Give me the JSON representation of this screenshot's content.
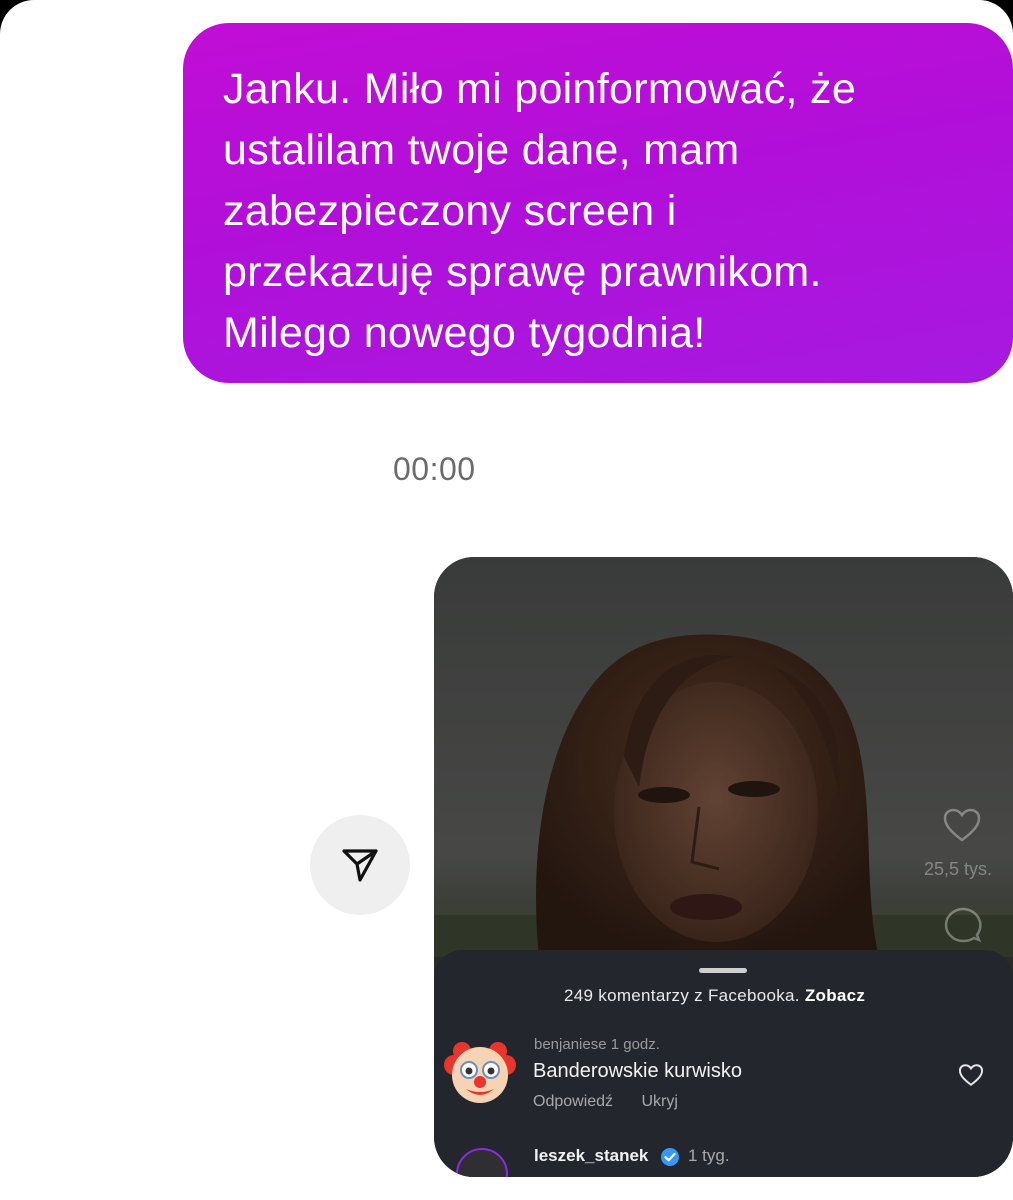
{
  "message": {
    "lines": [
      "Janku. Miło mi poinformować, że",
      "ustalilam twoje dane, mam",
      "zabezpieczony screen i",
      "przekazuję sprawę prawnikom.",
      "Milego nowego tygodnia!"
    ]
  },
  "timestamp": "00:00",
  "reel": {
    "likes": "25,5 tys.",
    "sheet": {
      "facebook_count": "249 komentarzy z Facebooka.",
      "facebook_link": "Zobacz",
      "comment1": {
        "meta": "benjaniese 1 godz.",
        "text": "Banderowskie kurwisko",
        "reply": "Odpowiedź",
        "hide": "Ukryj"
      },
      "comment2": {
        "username": "leszek_stanek",
        "time": "1 tyg."
      }
    }
  },
  "colors": {
    "bubble": "#b50fd8",
    "sheet": "#23272d",
    "verified": "#3897f0"
  },
  "icons": {
    "share": "send-icon",
    "avatar": "clown-face-emoji",
    "like": "heart-icon",
    "comment": "comment-icon",
    "verified": "verified-badge-icon"
  }
}
